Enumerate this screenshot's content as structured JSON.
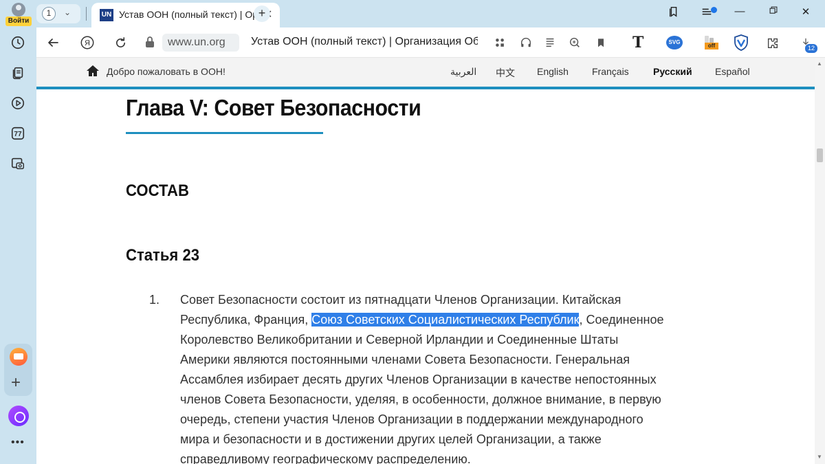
{
  "sidebar": {
    "login_label": "Войти",
    "items": [
      {
        "icon": "history-icon"
      },
      {
        "icon": "collections-icon"
      },
      {
        "icon": "video-icon"
      },
      {
        "icon": "speed-dial-icon",
        "label": "77"
      },
      {
        "icon": "screenshot-icon"
      }
    ],
    "bottom": [
      {
        "icon": "mail-icon"
      },
      {
        "icon": "add-icon"
      },
      {
        "icon": "alice-icon"
      },
      {
        "icon": "more-icon"
      }
    ]
  },
  "tabbar": {
    "tab_count": "1",
    "active_tab": {
      "favicon_text": "UN",
      "title": "Устав ООН (полный текст) | Организация Объединенных Наций"
    }
  },
  "addressbar": {
    "url": "www.un.org",
    "page_title": "Устав ООН (полный текст) | Организация Объединенных Наций",
    "extensions": {
      "t_label": "T",
      "svg_label": "SVG",
      "off_label": "off",
      "downloads_count": "12"
    }
  },
  "site_header": {
    "welcome": "Добро пожаловать в ООН!",
    "languages": [
      "العربية",
      "中文",
      "English",
      "Français",
      "Русский",
      "Español"
    ],
    "active_language": "Русский"
  },
  "content": {
    "chapter_title": "Глава V: Совет Безопасности",
    "section_title": "СОСТАВ",
    "article_title": "Статья 23",
    "item_number": "1.",
    "paragraph_lines": [
      "Совет Безопасности состоит из пятнадцати Членов Организации. Китайская",
      "Республика, Франция, ",
      "Союз Советских Социалистических Республик",
      ", Соединенное",
      "Королевство Великобритании и Северной Ирландии и Соединенные Штаты",
      "Америки являются постоянными членами Совета Безопасности. Генеральная",
      "Ассамблея избирает десять других Членов Организации в качестве непостоянных",
      "членов Совета Безопасности, уделяя, в особенности, должное внимание, в первую",
      "очередь, степени участия Членов Организации в поддержании международного",
      "мира и безопасности и в достижении других целей Организации, а также",
      "справедливому географическому распределению."
    ]
  },
  "colors": {
    "sidebar_bg": "#cce3f0",
    "accent_blue": "#1e8fbf",
    "selection": "#2f7fe8",
    "login_badge": "#ffd13a"
  }
}
